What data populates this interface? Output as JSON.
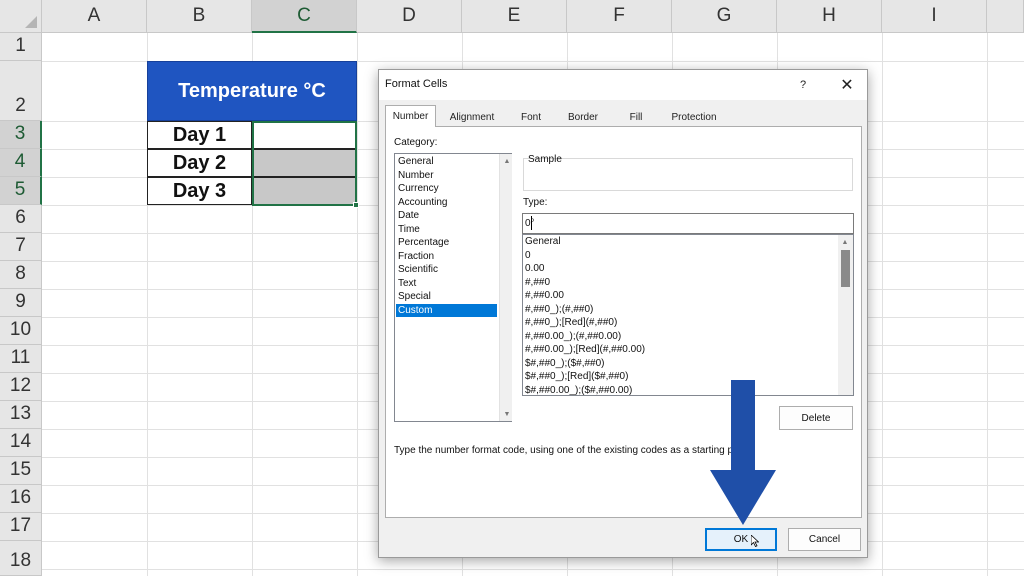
{
  "spreadsheet": {
    "columns": [
      "A",
      "B",
      "C",
      "D",
      "E",
      "F",
      "G",
      "H",
      "I"
    ],
    "rows": [
      "1",
      "2",
      "3",
      "4",
      "5",
      "6",
      "7",
      "8",
      "9",
      "10",
      "11",
      "12",
      "13",
      "14",
      "15",
      "16",
      "17",
      "18"
    ],
    "header_cell": "Temperature °C",
    "days": [
      "Day 1",
      "Day 2",
      "Day 3"
    ],
    "colors": {
      "header_fill": "#1f55c1",
      "selection": "#217346"
    }
  },
  "dialog": {
    "title": "Format Cells",
    "help": "?",
    "close": "✕",
    "tabs": [
      "Number",
      "Alignment",
      "Font",
      "Border",
      "Fill",
      "Protection"
    ],
    "active_tab": "Number",
    "category_label": "Category:",
    "categories": [
      "General",
      "Number",
      "Currency",
      "Accounting",
      "Date",
      "Time",
      "Percentage",
      "Fraction",
      "Scientific",
      "Text",
      "Special",
      "Custom"
    ],
    "selected_category": "Custom",
    "sample_label": "Sample",
    "type_label": "Type:",
    "type_value": "0°",
    "type_list": [
      "General",
      "0",
      "0.00",
      "#,##0",
      "#,##0.00",
      "#,##0_);(#,##0)",
      "#,##0_);[Red](#,##0)",
      "#,##0.00_);(#,##0.00)",
      "#,##0.00_);[Red](#,##0.00)",
      "$#,##0_);($#,##0)",
      "$#,##0_);[Red]($#,##0)",
      "$#,##0.00_);($#,##0.00)"
    ],
    "delete_label": "Delete",
    "hint": "Type the number format code, using one of the existing codes as a starting point.",
    "ok_label": "OK",
    "cancel_label": "Cancel"
  },
  "overlay": {
    "arrow_color": "#1f4fa8",
    "arrow_icon": "down-arrow-icon"
  }
}
